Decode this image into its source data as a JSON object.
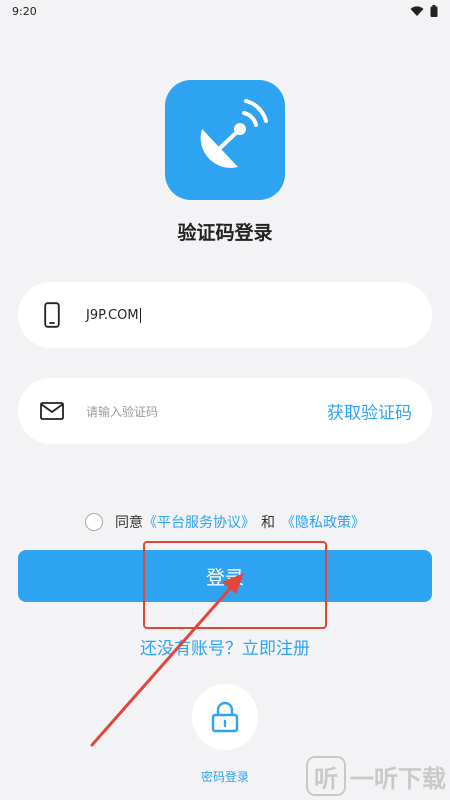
{
  "status_bar": {
    "time": "9:20"
  },
  "page": {
    "title": "验证码登录"
  },
  "phone_field": {
    "value": "J9P.COM"
  },
  "code_field": {
    "placeholder": "请输入验证码",
    "get_code_label": "获取验证码"
  },
  "agreement": {
    "prefix": "同意",
    "service_link": "《平台服务协议》",
    "and": "和",
    "privacy_link": "《隐私政策》"
  },
  "login_button": {
    "label": "登录"
  },
  "register": {
    "label": "还没有账号？立即注册"
  },
  "password_login": {
    "label": "密码登录"
  },
  "watermark": {
    "badge": "听",
    "text": "一听下载"
  },
  "colors": {
    "accent": "#2ea3f2",
    "background": "#f3f3f5",
    "annotation": "#e0463c"
  }
}
